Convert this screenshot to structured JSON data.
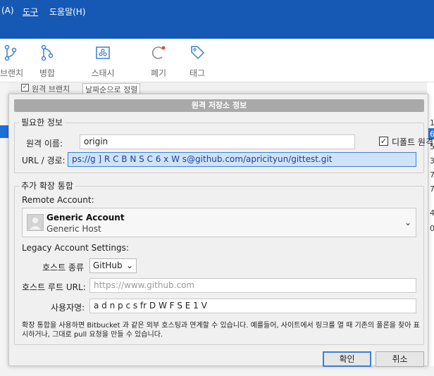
{
  "menubar": {
    "items": [
      "(A)",
      "도구",
      "도움말(H)"
    ],
    "color": "#1559b5"
  },
  "toolbar": {
    "buttons": [
      {
        "label": "브랜치",
        "icon": "branch-icon"
      },
      {
        "label": "병합",
        "icon": "merge-icon"
      },
      {
        "label": "스태시",
        "icon": "stash-icon"
      },
      {
        "label": "폐기",
        "icon": "discard-icon"
      },
      {
        "label": "태그",
        "icon": "tag-icon"
      }
    ]
  },
  "subbar": {
    "checkbox_label": "원격 브랜치",
    "sort_label": "날짜순으로 정렬"
  },
  "right_numbers": [
    "1",
    "6",
    "5",
    "3",
    "7",
    "7",
    "4",
    "0"
  ],
  "dialog": {
    "title": "원격 저장소 정보",
    "required": {
      "group_label": "필요한 정보",
      "name_label": "원격 이름:",
      "name_value": "origin",
      "default_remote_label": "디폴트 원격",
      "default_remote_checked": true,
      "url_label": "URL / 경로:",
      "url_value": "ps://g ] R C B N S C 6 x W s@github.com/apricityun/gittest.git"
    },
    "extended": {
      "group_label": "추가 확장 통합",
      "remote_account_label": "Remote Account:",
      "account_name": "Generic Account",
      "account_host": "Generic Host",
      "legacy_label": "Legacy Account Settings:",
      "host_type_label": "호스트 종류",
      "host_type_value": "GitHub",
      "host_root_label": "호스트 루트 URL:",
      "host_root_placeholder": "https://www.github.com",
      "username_label": "사용자명:",
      "username_value": "a d n p c s fr D W F S E 1 V",
      "note": "확장 통합을 사용하면 Bitbucket 과 같은 외부 호스팅과 연계할 수 있습니다. 예를들어, 사이트에서 링크를 열 때 기존의 풀론을 찾아 표시하거나, 그대로 pull 요청을 만들 수 있습니다."
    },
    "ok_label": "확인",
    "cancel_label": "취소",
    "accent": "#3a7fd5"
  }
}
